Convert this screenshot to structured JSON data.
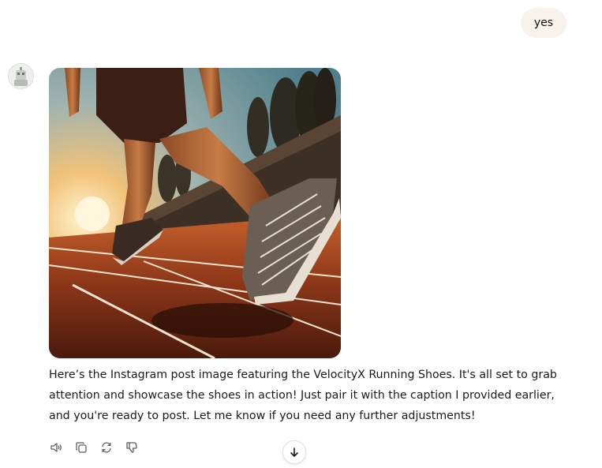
{
  "user_message": {
    "text": "yes",
    "bubble_color": "#f7f3ec"
  },
  "assistant": {
    "avatar_icon": "assistant-avatar-icon",
    "image_icon": "running-shoes-photo",
    "text": "Here’s the Instagram post image featuring the VelocityX Running Shoes. It's all set to grab attention and showcase the shoes in action! Just pair it with the caption I provided earlier, and you're ready to post. Let me know if you need any further adjustments!"
  },
  "actions": [
    {
      "icon": "speaker-icon"
    },
    {
      "icon": "copy-icon"
    },
    {
      "icon": "regenerate-icon"
    },
    {
      "icon": "thumbs-down-icon"
    }
  ],
  "scroll_button": {
    "icon": "arrow-down-icon"
  },
  "colors": {
    "text": "#1a1a1a",
    "icon": "#5d5d5d",
    "track": "#7a2d18",
    "sky_glow": "#f2c27a"
  }
}
